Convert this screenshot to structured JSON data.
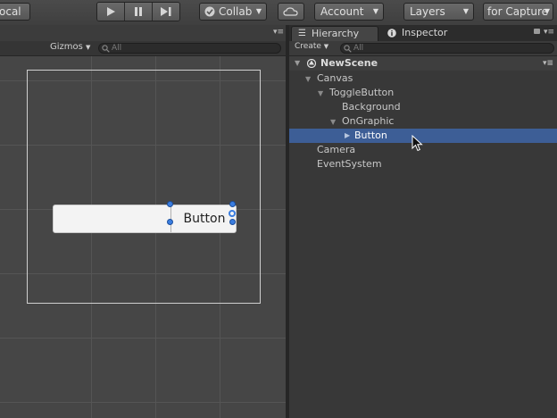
{
  "toolbar": {
    "local_label": "ocal",
    "collab_label": "Collab",
    "account_label": "Account",
    "layers_label": "Layers",
    "layout_label": "for Capture"
  },
  "scene": {
    "gizmos_label": "Gizmos",
    "search_placeholder": "All",
    "ui_button_label": "Button"
  },
  "hierarchy": {
    "tab_hierarchy": "Hierarchy",
    "tab_inspector": "Inspector",
    "create_label": "Create",
    "search_placeholder": "All",
    "scene_name": "NewScene",
    "items": [
      {
        "label": "Canvas"
      },
      {
        "label": "ToggleButton"
      },
      {
        "label": "Background"
      },
      {
        "label": "OnGraphic"
      },
      {
        "label": "Button"
      },
      {
        "label": "Camera"
      },
      {
        "label": "EventSystem"
      }
    ]
  }
}
